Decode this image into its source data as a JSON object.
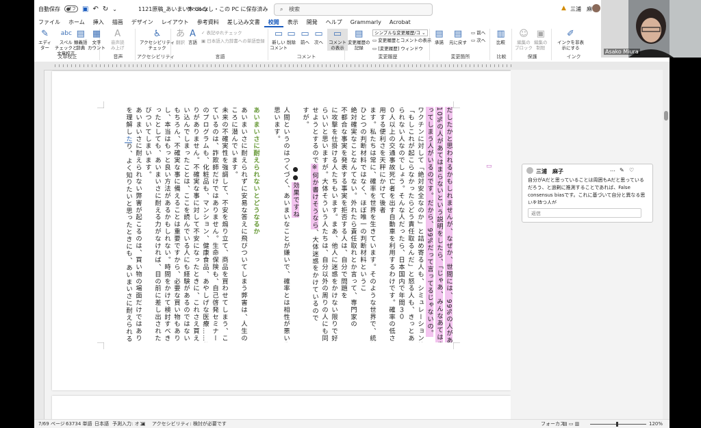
{
  "title_bar": {
    "autosave_label": "自動保存",
    "autosave_state": "オフ",
    "filename": "1121原稿_あいまい本.docx",
    "label_status": "ラベルなし・この PC に保存済み",
    "search_placeholder": "検索",
    "user_name": "三浦　麻子"
  },
  "menu": [
    "ファイル",
    "ホーム",
    "挿入",
    "描画",
    "デザイン",
    "レイアウト",
    "参考資料",
    "差し込み文書",
    "校閲",
    "表示",
    "開発",
    "ヘルプ",
    "Grammarly",
    "Acrobat"
  ],
  "menu_active": "校閲",
  "ribbon": {
    "proofing": {
      "name": "文章校正",
      "editor": "エディ\nター",
      "spell": "スペル\nチェックと\n文章校正",
      "thesaurus": "類義語\n辞典",
      "wordcount": "文字\nカウント"
    },
    "speech": {
      "name": "音声",
      "readaloud": "音声読\nみ上げ"
    },
    "accessibility": {
      "name": "アクセシビリティ",
      "check": "アクセシビリティ\nチェック"
    },
    "language": {
      "name": "言語",
      "translate": "翻訳",
      "language": "言語",
      "jp_check": "表記ゆれチェック",
      "jp_dict": "日本語入力辞書への単語登録"
    },
    "comments": {
      "name": "コメント",
      "new": "新しい\nコメント",
      "delete": "削除",
      "prev": "前へ",
      "next": "次へ",
      "show": "コメント\nの表示"
    },
    "tracking": {
      "name": "変更履歴",
      "track": "変更履歴の\n記録",
      "display": "シンプルな変更履歴/コ",
      "markup": "変更履歴とコメントの表示",
      "pane": "[変更履歴] ウィンドウ"
    },
    "changes": {
      "name": "変更箇所",
      "accept": "承諾",
      "reject": "元に戻す",
      "prev": "前へ",
      "next": "次へ"
    },
    "compare": {
      "name": "比較",
      "compare": "比較"
    },
    "protect": {
      "name": "保護",
      "block": "編集の\nブロック",
      "restrict": "編集の\n制限"
    },
    "ink": {
      "name": "インク",
      "hide": "インクを非表\n示にする"
    }
  },
  "document": {
    "col1_hl": "だしたかと思われるかもしれませんが、なぜか、世間には、99%の人があてはまって、",
    "col2_hl": "10%の人があてはまらないという説明をしたら、「じゃあ、みんなあてはまるんだ」と思",
    "col3_hl": "ってしまう人がいるのです。だから、99%だって言ってるじゃないの。",
    "col4": "ワクチンに対して「絶対安全なのか」と詰め寄る人も、シミュレーション結果に対して",
    "col5": "「もしこれが起こらなかったらどう責任取るんだ」と怒る人も、きっとあいまいに耐え",
    "col6": "られない人なのでしょう。そんな人だったら、日本国内で年間３０",
    "col7": "０人以上の交通事故死亡者を出す自動車を利用するわけです。確率の低さと自動車を利",
    "col8": "用する便利さを天秤にかけて後者",
    "col9": "ます。私たちは常に、確率を世界を生きています。そのような世界で、統計や量的データは",
    "col10": "ひとつの判断材料ではなく、ほぼ唯一の判断材料というこ",
    "col11": "絶対確実なことなんてない。外れたら責任取れとか言って、専門家の",
    "col12": "不都合な事実を発表する事実を拒否する人は、自分で問題を",
    "col13": "に攻撃を仕掛ける人たちもいます。まあ、他人に迷惑をかけない限りで好きにした",
    "col14": "らいいと思いますが。大体そういう人たちは、自分以外の周りの人にも同じ主張を認め",
    "col15_a": "せようとするので",
    "col15_b": "※何か書けそうなら",
    "col15_c": "、大体迷惑をかけているので",
    "col16": "すが。",
    "col17_pre": "●●",
    "col17_hl": "効果ですね",
    "col18": "人間というのはつくづく、あいまいなことが嫌いで、確率とは相性が悪い生き物だなと",
    "col19": "思います。",
    "heading": "あいまいさに耐えられないとどうなるか",
    "col21": "あいまいさに耐えられずに安易な答えに飛びついてしまう弊害は、人生のいろいろなと",
    "col22": "ころに潜んでいます。",
    "col23": "未来の不確実性を強調して、不安を煽り立て、商品を買わせてしまう、こんなこともし",
    "col24": "ているのは、詐欺師だけではありません。生命保険も、自己啓発セミナーも、ダイエット",
    "col25": "のプログラムも、化粧品も、マンション、健康食品、あやしげな医療……数え上げればき",
    "col26": "りがありません。不確実な事に対して不安になったときに、これさえ買えば大丈夫と思",
    "col27": "い込んでしまったことは、ここを読んでいる人にも経験があるのではないでしょうか。",
    "col28": "もちろん、不確実な事に備えることは重要ですから、必要な買い物もあります。しか",
    "col29": "し、本当はもっと良い方法があるかもしれない。時間をかけて検討すべきことだったりするこ",
    "col30": "ったとしても、あいまいさに耐える力がなければ、目の前に差し出されたものに早々に飛",
    "col31": "びついてしまいます。",
    "col32": "あいまいさに耐えられない弊害が起こるのは、買い物の場面だけではありません。物事",
    "col33_pre": "を理解し",
    "col33_b": "た",
    "col33_post": "り、よく知りたいと思ったときにも、あいまいさに耐えられると、すぐに結論を"
  },
  "comment": {
    "author": "三浦　麻子",
    "text": "自分がAだと思っていることは周囲もAだと思っているだろう、と過剰に推測することであれば、False consensus biasです。これに基づいて自分と異なる思いを持つ人が",
    "reply_placeholder": "返信"
  },
  "status": {
    "page": "7/69 ページ",
    "words": "63734 単語",
    "lang": "日本語",
    "predict": "予測入力: オン",
    "accessibility": "アクセシビリティ: 検討が必要です",
    "focus": "フォーカス",
    "zoom": "120%"
  },
  "video": {
    "name": "Asako Miura"
  },
  "colors": {
    "accent": "#185abd",
    "highlight": "#f3c4ef",
    "heading": "#6a9b3a"
  }
}
